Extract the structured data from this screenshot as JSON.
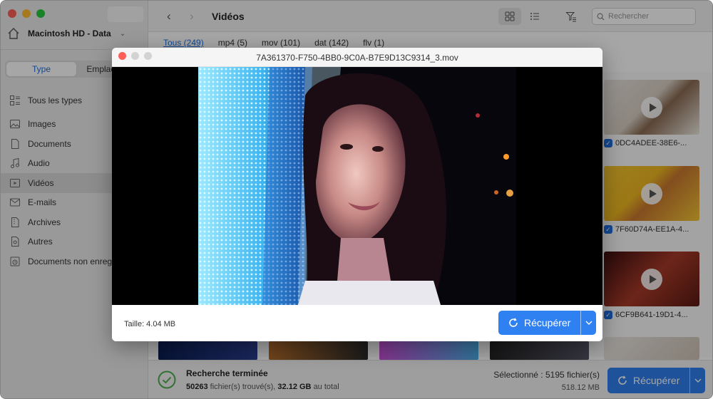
{
  "sidebar": {
    "drive": "Macintosh HD - Data",
    "segments": [
      "Type",
      "Emplacement"
    ],
    "items": [
      {
        "label": "Tous les types",
        "icon": "all-types-icon"
      },
      {
        "label": "Images",
        "icon": "image-icon"
      },
      {
        "label": "Documents",
        "icon": "document-icon"
      },
      {
        "label": "Audio",
        "icon": "music-icon"
      },
      {
        "label": "Vidéos",
        "icon": "video-icon"
      },
      {
        "label": "E-mails",
        "icon": "mail-icon"
      },
      {
        "label": "Archives",
        "icon": "archive-icon"
      },
      {
        "label": "Autres",
        "icon": "other-icon"
      },
      {
        "label": "Documents non enregistrés",
        "icon": "unsaved-doc-icon"
      }
    ]
  },
  "toolbar": {
    "title": "Vidéos",
    "search_placeholder": "Rechercher"
  },
  "filters": [
    "Tous (249)",
    "mp4 (5)",
    "mov (101)",
    "dat (142)",
    "flv (1)"
  ],
  "cards": [
    {
      "label": "0DC4ADEE-38E6-..."
    },
    {
      "label": "7F60D74A-EE1A-4..."
    },
    {
      "label": "6CF9B641-19D1-4..."
    }
  ],
  "status": {
    "title": "Recherche terminée",
    "found_count": "50263",
    "found_text": "fichier(s) trouvé(s),",
    "total_size": "32.12 GB",
    "total_text": "au total",
    "selected": "Sélectionné : 5195 fichier(s)",
    "selected_size": "518.12 MB",
    "recover_label": "Récupérer"
  },
  "modal": {
    "title": "7A361370-F750-4BB0-9C0A-B7E9D13C9314_3.mov",
    "size": "Taille: 4.04 MB",
    "recover_label": "Récupérer"
  },
  "colors": {
    "accent": "#2f80f0",
    "success": "#4caf50"
  }
}
